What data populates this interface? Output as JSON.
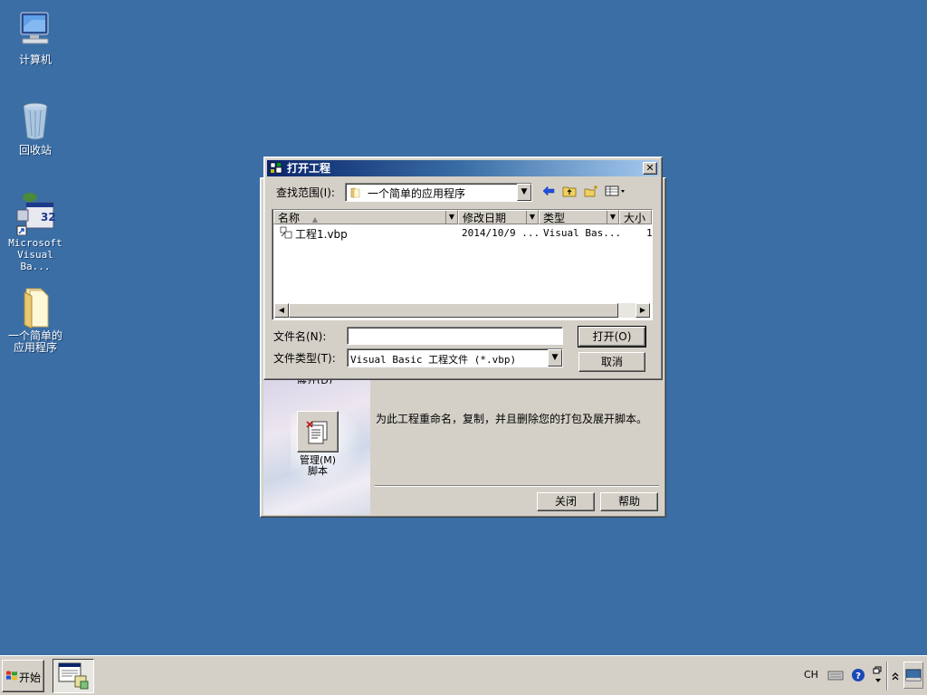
{
  "desktop": {
    "icons": [
      {
        "label": "计算机",
        "icon": "computer-icon"
      },
      {
        "label": "回收站",
        "icon": "recycle-bin-icon"
      },
      {
        "label": "Microsoft Visual Ba...",
        "icon": "visual-basic-icon"
      },
      {
        "label": "一个简单的应用程序",
        "icon": "folder-icon"
      }
    ]
  },
  "wizard": {
    "partial_label": "展开(D)",
    "manage_label": "管理(M)\n脚本",
    "description": "为此工程重命名，复制，并且删除您的打包及展开脚本。",
    "close_label": "关闭",
    "help_label": "帮助"
  },
  "dialog": {
    "title": "打开工程",
    "look_in_label": "查找范围(I):",
    "look_in_value": "一个简单的应用程序",
    "columns": [
      "名称",
      "修改日期",
      "类型",
      "大小"
    ],
    "files": [
      {
        "name": "工程1.vbp",
        "modified": "2014/10/9 ...",
        "type": "Visual Bas...",
        "size": "1"
      }
    ],
    "filename_label": "文件名(N):",
    "filename_value": "",
    "filetype_label": "文件类型(T):",
    "filetype_value": "Visual Basic 工程文件 (*.vbp)",
    "open_label": "打开(O)",
    "cancel_label": "取消"
  },
  "taskbar": {
    "start_label": "开始",
    "tray_lang": "CH"
  },
  "colors": {
    "desktop": "#3a6ea5",
    "titlebar_start": "#0a246a",
    "titlebar_end": "#a6caf0",
    "face": "#d4d0c8"
  }
}
